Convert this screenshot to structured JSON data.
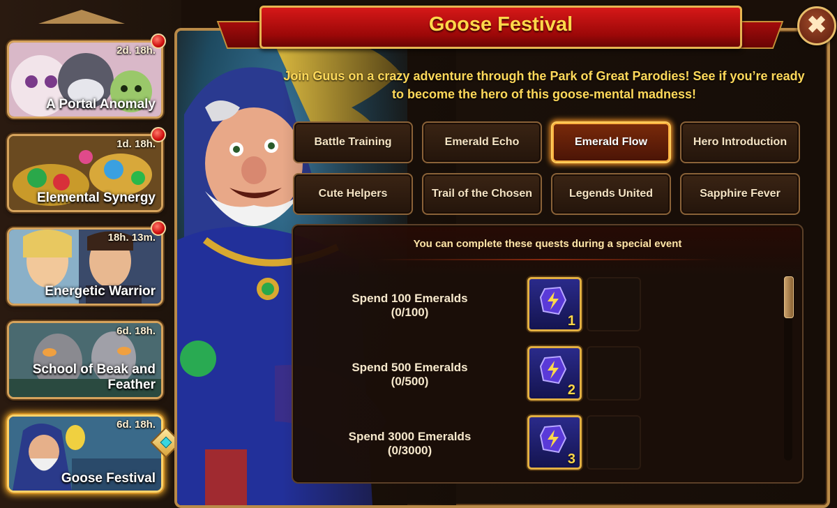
{
  "sidebar": {
    "events": [
      {
        "timer": "2d. 18h.",
        "title": "A Portal Anomaly",
        "has_notification": true
      },
      {
        "timer": "1d. 18h.",
        "title": "Elemental Synergy",
        "has_notification": true
      },
      {
        "timer": "18h. 13m.",
        "title": "Energetic Warrior",
        "has_notification": true
      },
      {
        "timer": "6d. 18h.",
        "title": "School of Beak and Feather",
        "has_notification": false
      },
      {
        "timer": "6d. 18h.",
        "title": "Goose Festival",
        "has_notification": false,
        "active": true
      }
    ]
  },
  "panel": {
    "title": "Goose Festival",
    "close_label": "✖",
    "intro": "Join Guus on a crazy adventure through the Park of Great Parodies! See if you’re ready to become the hero of this goose-mental madness!"
  },
  "tabs": [
    {
      "label": "Battle Training"
    },
    {
      "label": "Emerald Echo"
    },
    {
      "label": "Emerald Flow",
      "selected": true
    },
    {
      "label": "Hero Introduction"
    },
    {
      "label": "Cute Helpers"
    },
    {
      "label": "Trail of the Chosen"
    },
    {
      "label": "Legends United"
    },
    {
      "label": "Sapphire Fever"
    }
  ],
  "quests": {
    "header": "You can complete these quests during a special event",
    "items": [
      {
        "name": "Spend 100 Emeralds",
        "progress": "(0/100)",
        "reward_icon": "lightning-crystal-icon",
        "reward_qty": "1"
      },
      {
        "name": "Spend 500 Emeralds",
        "progress": "(0/500)",
        "reward_icon": "lightning-crystal-icon",
        "reward_qty": "2"
      },
      {
        "name": "Spend 3000 Emeralds",
        "progress": "(0/3000)",
        "reward_icon": "lightning-crystal-icon",
        "reward_qty": "3"
      }
    ]
  },
  "colors": {
    "gold": "#ffd84a",
    "banner_red": "#c01010",
    "frame": "#b98a48",
    "selected_glow": "#ff9a28"
  }
}
